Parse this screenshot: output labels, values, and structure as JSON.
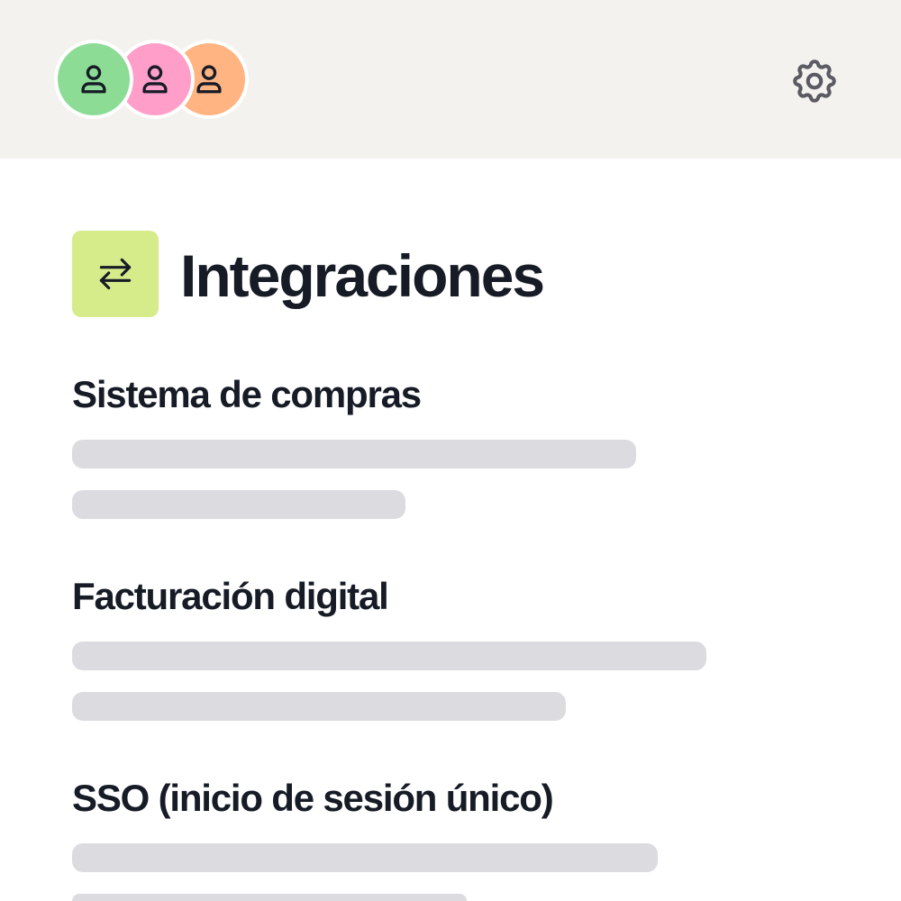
{
  "colors": {
    "topbar_bg": "#f4f2ef",
    "avatar_colors": [
      "#8cdc96",
      "#ff9ec8",
      "#ffb482"
    ],
    "integrations_icon_bg": "#d6ec8a",
    "skeleton": "#dcdbe0",
    "text": "#161b26",
    "icon_stroke": "#5a5a62"
  },
  "header": {
    "avatars": [
      {
        "icon": "user-icon"
      },
      {
        "icon": "user-icon"
      },
      {
        "icon": "user-icon"
      }
    ],
    "settings_icon": "gear-icon"
  },
  "page": {
    "title": "Integraciones",
    "title_icon": "arrows-swap-icon",
    "sections": [
      {
        "title": "Sistema de compras"
      },
      {
        "title": "Facturación digital"
      },
      {
        "title": "SSO (inicio de sesión único)"
      }
    ]
  }
}
